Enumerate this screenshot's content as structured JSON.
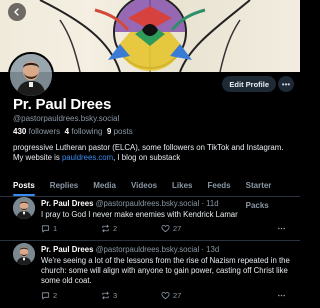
{
  "profile": {
    "name": "Pr. Paul Drees",
    "handle": "@pastorpauldrees.bsky.social",
    "followers_count": "430",
    "followers_label": "followers",
    "following_count": "4",
    "following_label": "following",
    "posts_count": "9",
    "posts_label": "posts",
    "bio_text": "progressive Lutheran pastor (ELCA), some followers on TikTok and Instagram. My website is",
    "bio_link": "pauldrees.com",
    "bio_tail": ", I blog on substack"
  },
  "header": {
    "edit_label": "Edit Profile",
    "more_glyph": "•••"
  },
  "tabs": [
    {
      "label": "Posts"
    },
    {
      "label": "Replies"
    },
    {
      "label": "Media"
    },
    {
      "label": "Videos"
    },
    {
      "label": "Likes"
    },
    {
      "label": "Feeds"
    },
    {
      "label": "Starter Packs"
    }
  ],
  "posts": [
    {
      "author": "Pr. Paul Drees",
      "handle": "@pastorpauldrees.bsky.social",
      "time": "11d",
      "text": "I pray to God I never make enemies with Kendrick Lamar",
      "replies": "1",
      "reposts": "2",
      "likes": "27"
    },
    {
      "author": "Pr. Paul Drees",
      "handle": "@pastorpauldrees.bsky.social",
      "time": "13d",
      "text": "We're seeing a lot of the lessons from the rise of Nazism repeated in the church: some will align with anyone to gain power, casting off Christ like some old coat.",
      "replies": "2",
      "reposts": "3",
      "likes": "27"
    }
  ],
  "colors": {
    "accent": "#3b8cf2",
    "muted": "#8b98a5",
    "background": "#000000"
  }
}
